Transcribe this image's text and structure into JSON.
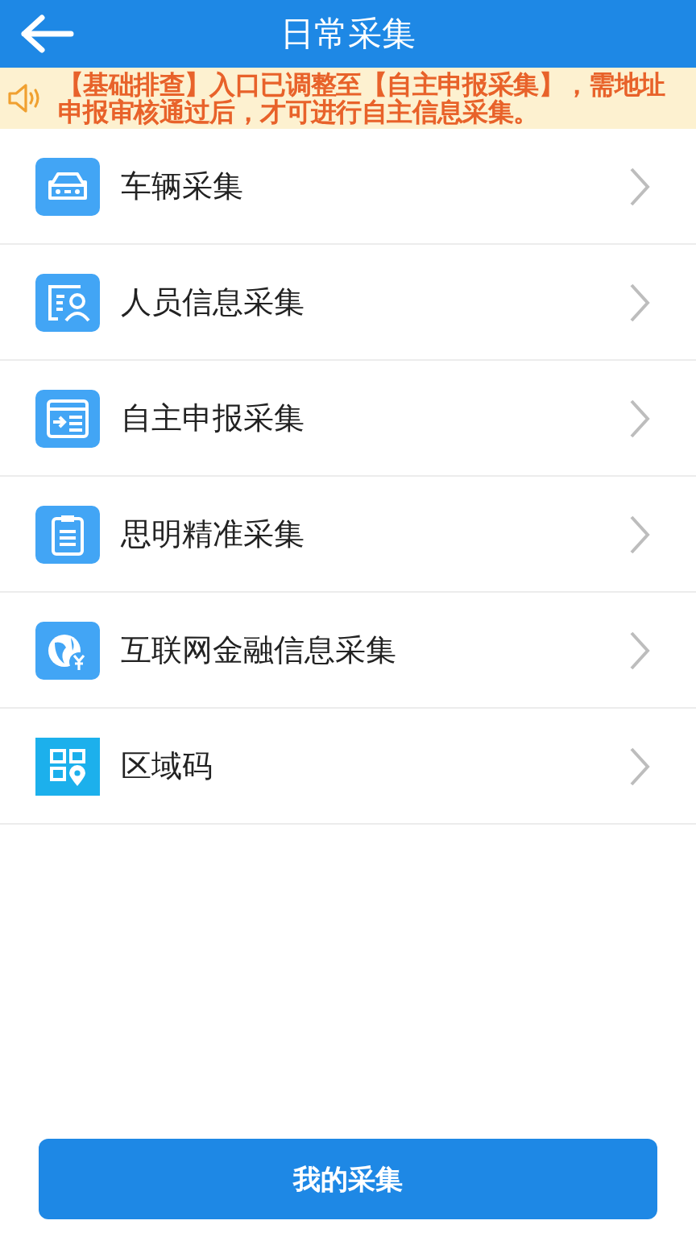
{
  "header": {
    "title": "日常采集"
  },
  "notice": {
    "text": "【基础排查】入口已调整至【自主申报采集】，需地址申报审核通过后，才可进行自主信息采集。"
  },
  "items": [
    {
      "label": "车辆采集"
    },
    {
      "label": "人员信息采集"
    },
    {
      "label": "自主申报采集"
    },
    {
      "label": "思明精准采集"
    },
    {
      "label": "互联网金融信息采集"
    },
    {
      "label": "区域码"
    }
  ],
  "footer_button": "我的采集"
}
